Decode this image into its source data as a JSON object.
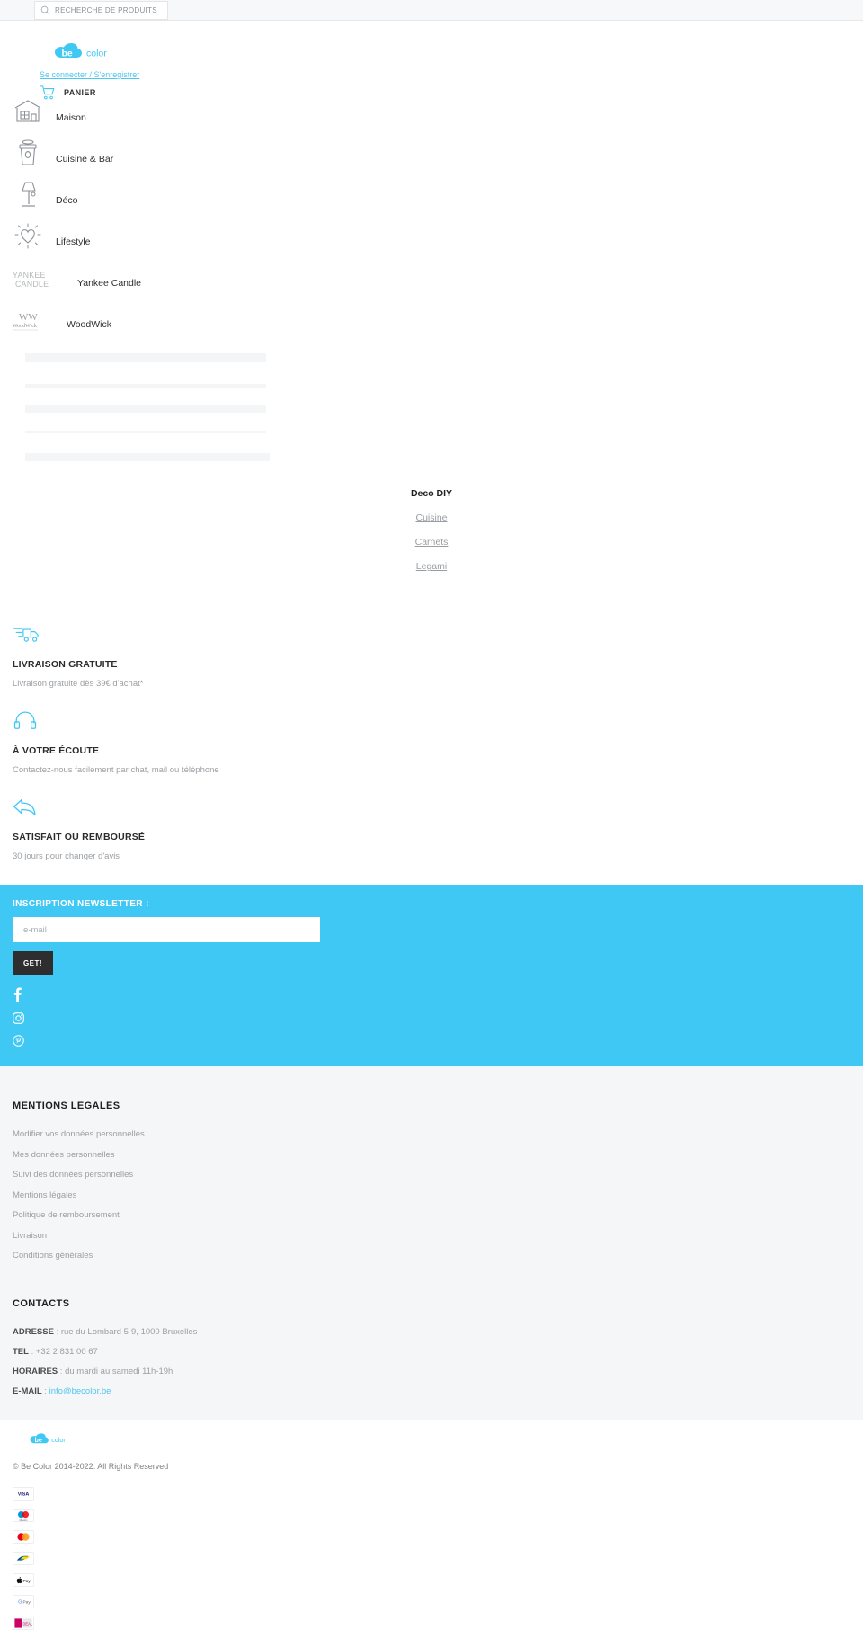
{
  "search": {
    "placeholder": "RECHERCHE DE PRODUITS",
    "icon": "search-icon"
  },
  "header": {
    "logo_text_be": "be",
    "logo_text_color": "color",
    "account_link": "Se connecter / S'enregistrer",
    "cart_label": "PANIER",
    "cart_icon": "cart-icon"
  },
  "nav": {
    "items": [
      {
        "label": "Maison",
        "icon": "house-icon"
      },
      {
        "label": "Cuisine & Bar",
        "icon": "coffee-cup-icon"
      },
      {
        "label": "Déco",
        "icon": "lamp-icon"
      },
      {
        "label": "Lifestyle",
        "icon": "sun-heart-icon"
      },
      {
        "label": "Yankee Candle",
        "icon": "yankee-candle-logo"
      },
      {
        "label": "WoodWick",
        "icon": "woodwick-logo"
      }
    ],
    "brand_yankee_line1": "YANKEE",
    "brand_yankee_line2": "CANDLE",
    "brand_woodwick_mark": "WW",
    "brand_woodwick_name": "WoodWick"
  },
  "center_links": {
    "heading": "Deco DIY",
    "links": [
      "Cuisine",
      "Carnets",
      "Legami"
    ]
  },
  "services": [
    {
      "icon": "delivery-truck-icon",
      "title": "LIVRAISON GRATUITE",
      "text": "Livraison gratuite dès 39€ d'achat*"
    },
    {
      "icon": "headset-icon",
      "title": "À VOTRE ÉCOUTE",
      "text": "Contactez-nous facilement par chat, mail ou téléphone"
    },
    {
      "icon": "return-arrow-icon",
      "title": "SATISFAIT OU REMBOURSÉ",
      "text": "30 jours pour changer d'avis"
    }
  ],
  "newsletter": {
    "title": "INSCRIPTION NEWSLETTER :",
    "placeholder": "e-mail",
    "value": "",
    "button_label": "GET!",
    "background": "#3fc8f4",
    "socials": [
      {
        "name": "facebook-icon"
      },
      {
        "name": "instagram-icon"
      },
      {
        "name": "pinterest-icon"
      }
    ]
  },
  "legal": {
    "heading": "MENTIONS LEGALES",
    "links": [
      "Modifier vos données personnelles",
      "Mes données personnelles",
      "Suivi des données personnelles",
      "Mentions légales",
      "Politique de remboursement",
      "Livraison",
      "Conditions générales"
    ]
  },
  "contacts": {
    "heading": "CONTACTS",
    "address_label": "ADRESSE",
    "address_value": " : rue du Lombard 5-9, 1000 Bruxelles",
    "tel_label": "TEL",
    "tel_value": " : +32 2 831 00 67",
    "hours_label": "HORAIRES",
    "hours_value": " : du mardi au samedi 11h-19h",
    "email_label": "E-MAIL",
    "email_sep": " : ",
    "email_value": "info@becolor.be"
  },
  "bottom": {
    "copyright": "© Be Color 2014-2022. All Rights Reserved",
    "payments": [
      {
        "name": "visa-icon",
        "label": "VISA"
      },
      {
        "name": "maestro-icon",
        "label": "Maestro"
      },
      {
        "name": "mastercard-icon",
        "label": "Mastercard"
      },
      {
        "name": "bancontact-icon",
        "label": "Bancontact"
      },
      {
        "name": "apple-pay-icon",
        "label": "Pay"
      },
      {
        "name": "google-pay-icon",
        "label": "G Pay"
      },
      {
        "name": "ideal-icon",
        "label": "iDEAL"
      }
    ]
  },
  "colors": {
    "accent": "#3fc8f4",
    "link": "#4fc6f0",
    "dark": "#2e2e2e"
  }
}
